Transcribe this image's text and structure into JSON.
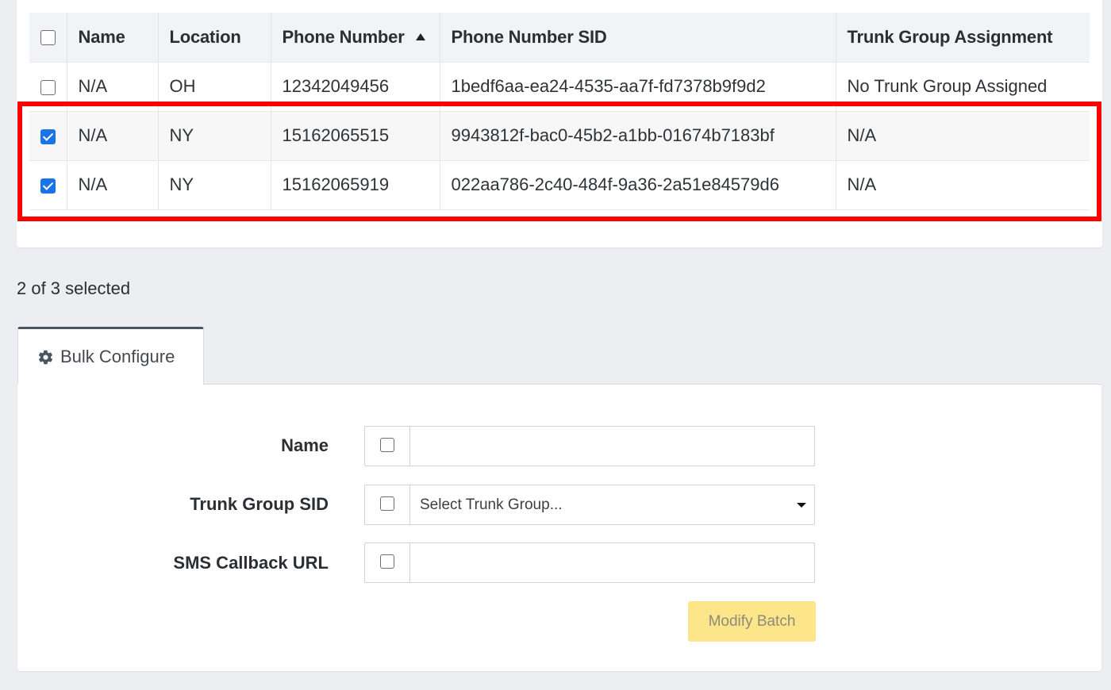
{
  "table": {
    "columns": [
      "Name",
      "Location",
      "Phone Number",
      "Phone Number SID",
      "Trunk Group Assignment"
    ],
    "sorted_column": "Phone Number",
    "sort_direction": "ascending",
    "select_all_checked": false,
    "rows": [
      {
        "checked": false,
        "name": "N/A",
        "location": "OH",
        "phone_number": "12342049456",
        "sid": "1bedf6aa-ea24-4535-aa7f-fd7378b9f9d2",
        "trunk_group": "No Trunk Group Assigned"
      },
      {
        "checked": true,
        "name": "N/A",
        "location": "NY",
        "phone_number": "15162065515",
        "sid": "9943812f-bac0-45b2-a1bb-01674b7183bf",
        "trunk_group": "N/A"
      },
      {
        "checked": true,
        "name": "N/A",
        "location": "NY",
        "phone_number": "15162065919",
        "sid": "022aa786-2c40-484f-9a36-2a51e84579d6",
        "trunk_group": "N/A"
      }
    ]
  },
  "selection": {
    "summary": "2 of 3 selected"
  },
  "bulk_configure": {
    "tab_label": "Bulk Configure",
    "tab_icon": "gear-icon",
    "fields": {
      "name": {
        "label": "Name",
        "value": ""
      },
      "trunk_group": {
        "label": "Trunk Group SID",
        "placeholder": "Select Trunk Group..."
      },
      "sms_callback": {
        "label": "SMS Callback URL",
        "value": ""
      }
    },
    "submit_label": "Modify Batch"
  },
  "colors": {
    "highlight": "#ff0000",
    "checkbox_checked": "#1a73e8",
    "button_disabled": "#fde58a"
  }
}
